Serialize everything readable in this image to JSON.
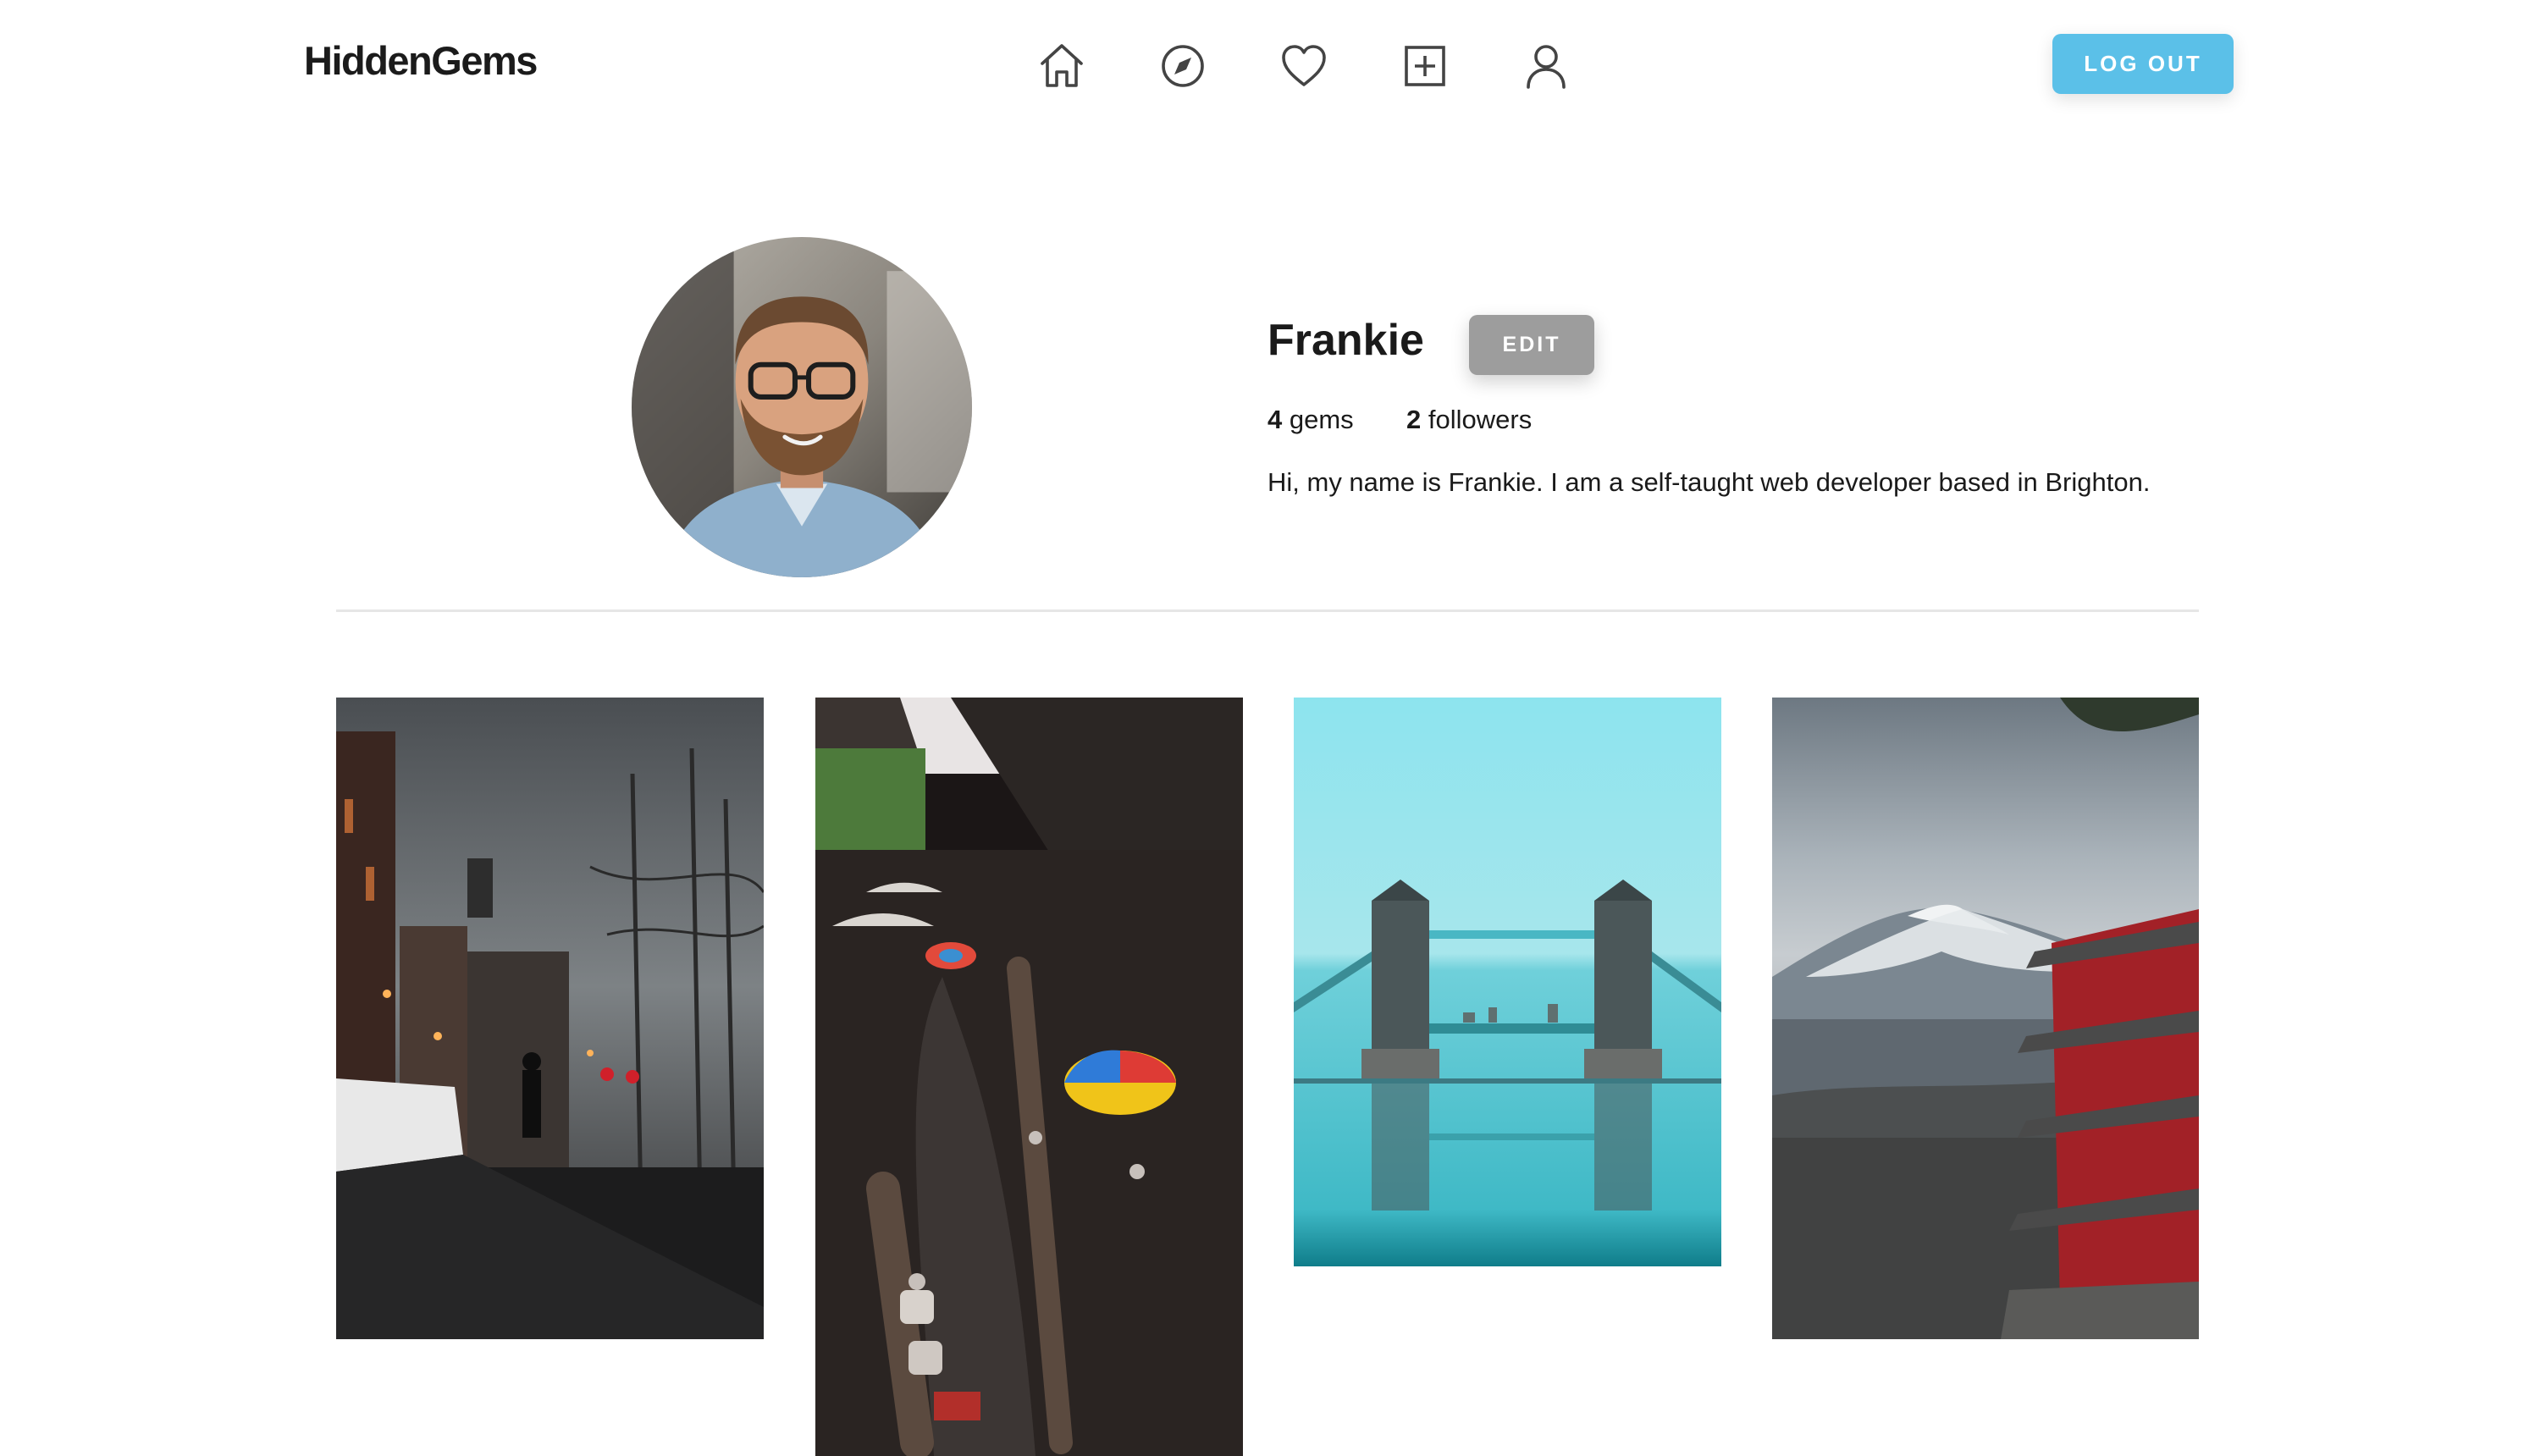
{
  "app": {
    "brand": "HiddenGems"
  },
  "nav": {
    "items": [
      {
        "name": "home",
        "icon": "home-icon"
      },
      {
        "name": "explore",
        "icon": "compass-icon"
      },
      {
        "name": "favorites",
        "icon": "heart-icon"
      },
      {
        "name": "add-gem",
        "icon": "plus-square-icon"
      },
      {
        "name": "profile",
        "icon": "user-icon"
      }
    ],
    "logout_label": "LOG OUT"
  },
  "profile": {
    "name": "Frankie",
    "edit_label": "EDIT",
    "gems_count": "4",
    "gems_label": "gems",
    "followers_count": "2",
    "followers_label": "followers",
    "bio": "Hi, my name is Frankie. I am a self-taught web developer based in Brighton."
  },
  "gems": [
    {
      "index": 1
    },
    {
      "index": 2
    },
    {
      "index": 3
    },
    {
      "index": 4
    }
  ],
  "colors": {
    "accent": "#5bc0e8",
    "edit_button": "#9d9d9d",
    "divider": "#e6e6e6",
    "text": "#1a1a1a"
  }
}
